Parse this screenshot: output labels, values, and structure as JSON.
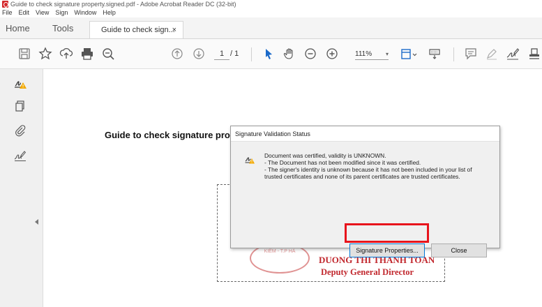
{
  "window": {
    "title": "Guide to check signature property.signed.pdf - Adobe Acrobat Reader DC (32-bit)"
  },
  "menu": {
    "items": [
      "File",
      "Edit",
      "View",
      "Sign",
      "Window",
      "Help"
    ]
  },
  "tabs": {
    "home": "Home",
    "tools": "Tools",
    "document": "Guide to check sign...",
    "close_glyph": "×"
  },
  "toolbar": {
    "page_current": "1",
    "page_total": "/ 1",
    "zoom": "111%",
    "zoom_caret": "▾"
  },
  "document": {
    "title": "Guide to check signature pro",
    "stamp_text": "KIỂM - T.P HÀ",
    "signer_name": "DUONG THI THANH TOAN",
    "signer_role": "Deputy General Director"
  },
  "dialog": {
    "title": "Signature Validation Status",
    "lines": [
      "Document was certified, validity is UNKNOWN.",
      "- The Document has not been modified since it was certified.",
      "- The signer's identity is unknown because it has not been included in your list of",
      "trusted certificates and none of its parent certificates are trusted certificates."
    ],
    "buttons": {
      "signature_properties": "Signature Properties...",
      "close": "Close"
    }
  },
  "colors": {
    "highlight": "#e8141c",
    "signature_red": "#c1272d",
    "acrobat_red": "#d4272b",
    "warning_yellow": "#f2a900"
  }
}
